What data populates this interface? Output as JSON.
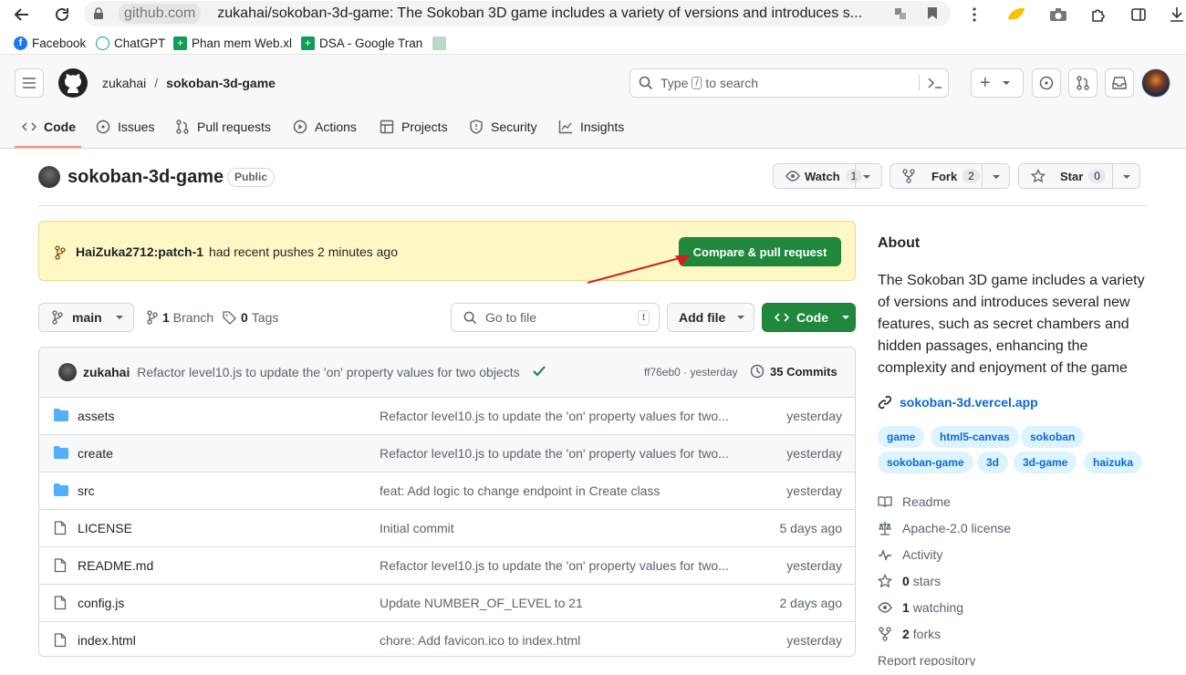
{
  "browser": {
    "host": "github.com",
    "title": "zukahai/sokoban-3d-game: The Sokoban 3D game includes a variety of versions and introduces s...",
    "bookmarks": [
      {
        "label": "Facebook",
        "icon": "facebook-icon",
        "color": "#1877f2"
      },
      {
        "label": "ChatGPT",
        "icon": "chatgpt-icon",
        "color": "#10a37f"
      },
      {
        "label": "Phan mem Web.xl",
        "icon": "sheets-icon",
        "color": "#0f9d58"
      },
      {
        "label": "DSA - Google Tran",
        "icon": "sheets-icon",
        "color": "#0f9d58"
      }
    ]
  },
  "header": {
    "owner": "zukahai",
    "slash": "/",
    "repo": "sokoban-3d-game",
    "search_prefix": "Type",
    "search_key": "/",
    "search_suffix": "to search",
    "plus": "+"
  },
  "tabs": [
    {
      "label": "Code",
      "icon": "code-icon"
    },
    {
      "label": "Issues",
      "icon": "issue-icon"
    },
    {
      "label": "Pull requests",
      "icon": "pull-request-icon"
    },
    {
      "label": "Actions",
      "icon": "play-icon"
    },
    {
      "label": "Projects",
      "icon": "table-icon"
    },
    {
      "label": "Security",
      "icon": "shield-icon"
    },
    {
      "label": "Insights",
      "icon": "graph-icon"
    }
  ],
  "repo": {
    "name": "sokoban-3d-game",
    "visibility": "Public",
    "watch_label": "Watch",
    "watch_count": "1",
    "fork_label": "Fork",
    "fork_count": "2",
    "star_label": "Star",
    "star_count": "0"
  },
  "banner": {
    "branch": "HaiZuka2712:patch-1",
    "text": "had recent pushes 2 minutes ago",
    "button": "Compare & pull request"
  },
  "toolbar": {
    "branch": "main",
    "branches": "1",
    "branches_label": "Branch",
    "tags": "0",
    "tags_label": "Tags",
    "goto_placeholder": "Go to file",
    "goto_key": "t",
    "add_file": "Add file",
    "code": "Code"
  },
  "commit": {
    "author": "zukahai",
    "message": "Refactor level10.js to update the 'on' property values for two objects",
    "hash_time": "ff76eb0 · yesterday",
    "count": "35 Commits"
  },
  "files": [
    {
      "name": "assets",
      "type": "folder",
      "message": "Refactor level10.js to update the 'on' property values for two...",
      "time": "yesterday"
    },
    {
      "name": "create",
      "type": "folder",
      "message": "Refactor level10.js to update the 'on' property values for two...",
      "time": "yesterday"
    },
    {
      "name": "src",
      "type": "folder",
      "message": "feat: Add logic to change endpoint in Create class",
      "time": "yesterday"
    },
    {
      "name": "LICENSE",
      "type": "file",
      "message": "Initial commit",
      "time": "5 days ago"
    },
    {
      "name": "README.md",
      "type": "file",
      "message": "Refactor level10.js to update the 'on' property values for two...",
      "time": "yesterday"
    },
    {
      "name": "config.js",
      "type": "file",
      "message": "Update NUMBER_OF_LEVEL to 21",
      "time": "2 days ago"
    },
    {
      "name": "index.html",
      "type": "file",
      "message": "chore: Add favicon.ico to index.html",
      "time": "yesterday"
    }
  ],
  "about": {
    "heading": "About",
    "description_lines": [
      "The Sokoban 3D game includes a variety",
      "of versions and introduces several new",
      "features, such as secret chambers and",
      "hidden passages, enhancing the",
      "complexity and enjoyment of the game"
    ],
    "link": "sokoban-3d.vercel.app",
    "topics": [
      "game",
      "html5-canvas",
      "sokoban",
      "sokoban-game",
      "3d",
      "3d-game",
      "haizuka"
    ],
    "items": [
      {
        "label": "Readme",
        "icon": "book-icon",
        "strong": ""
      },
      {
        "label": "Apache-2.0 license",
        "icon": "law-icon",
        "strong": ""
      },
      {
        "label": "Activity",
        "icon": "pulse-icon",
        "strong": ""
      },
      {
        "label": "stars",
        "icon": "star-icon",
        "strong": "0"
      },
      {
        "label": "watching",
        "icon": "eye-icon",
        "strong": "1"
      },
      {
        "label": "forks",
        "icon": "fork-icon",
        "strong": "2"
      },
      {
        "label": "Report repository",
        "icon": "",
        "strong": ""
      }
    ]
  },
  "colors": {
    "primary_green": "#1f883d",
    "link_blue": "#0969da",
    "banner_bg": "#fff8c5",
    "annotation_red": "#d32020"
  }
}
